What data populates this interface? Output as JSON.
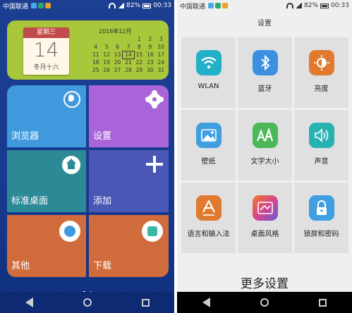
{
  "left_screen": {
    "status": {
      "carrier": "中国联通",
      "battery": "82%",
      "time": "00:33"
    },
    "calendar_widget": {
      "weekday": "星期三",
      "day": "14",
      "lunar": "冬月十六",
      "month_title": "2016年12月",
      "days": [
        "",
        "",
        "",
        "",
        "1",
        "2",
        "3",
        "4",
        "5",
        "6",
        "7",
        "8",
        "9",
        "10",
        "11",
        "12",
        "13",
        "14",
        "15",
        "16",
        "17",
        "18",
        "19",
        "20",
        "21",
        "22",
        "23",
        "24",
        "25",
        "26",
        "27",
        "28",
        "29",
        "30",
        "31"
      ],
      "today": "14"
    },
    "tiles": {
      "browser": {
        "label": "浏览器",
        "icon": "globe-icon",
        "color": "#3f99dc"
      },
      "settings": {
        "label": "设置",
        "icon": "gear-icon",
        "color": "#a864d8"
      },
      "desktop": {
        "label": "标准桌面",
        "icon": "home-icon",
        "color": "#2c8a97"
      },
      "add": {
        "label": "添加",
        "icon": "plus-icon",
        "color": "#4a57b5"
      },
      "other": {
        "label": "其他",
        "icon": "folder-icon",
        "color": "#d06c3c"
      },
      "download": {
        "label": "下载",
        "icon": "app-store-icon",
        "color": "#d06c3c"
      }
    },
    "page_dots": {
      "count": 2,
      "active": 1
    }
  },
  "right_screen": {
    "status": {
      "carrier": "中国联通",
      "battery": "82%",
      "time": "00:33"
    },
    "title": "设置",
    "items": [
      {
        "label": "WLAN",
        "icon": "wifi-icon",
        "color": "#22b0c8"
      },
      {
        "label": "蓝牙",
        "icon": "bluetooth-icon",
        "color": "#3d8fe0"
      },
      {
        "label": "亮度",
        "icon": "brightness-icon",
        "color": "#e07a2e"
      },
      {
        "label": "壁纸",
        "icon": "wallpaper-icon",
        "color": "#3f9fe0"
      },
      {
        "label": "文字大小",
        "icon": "font-size-icon",
        "color": "#4bb85a"
      },
      {
        "label": "声音",
        "icon": "speaker-icon",
        "color": "#28b3b3"
      },
      {
        "label": "语言和输入法",
        "icon": "language-icon",
        "color": "#e07a2e"
      },
      {
        "label": "桌面风格",
        "icon": "theme-icon",
        "color": "#d8448a"
      },
      {
        "label": "锁屏和密码",
        "icon": "lock-icon",
        "color": "#3f9fe0"
      }
    ],
    "more_label": "更多设置"
  }
}
